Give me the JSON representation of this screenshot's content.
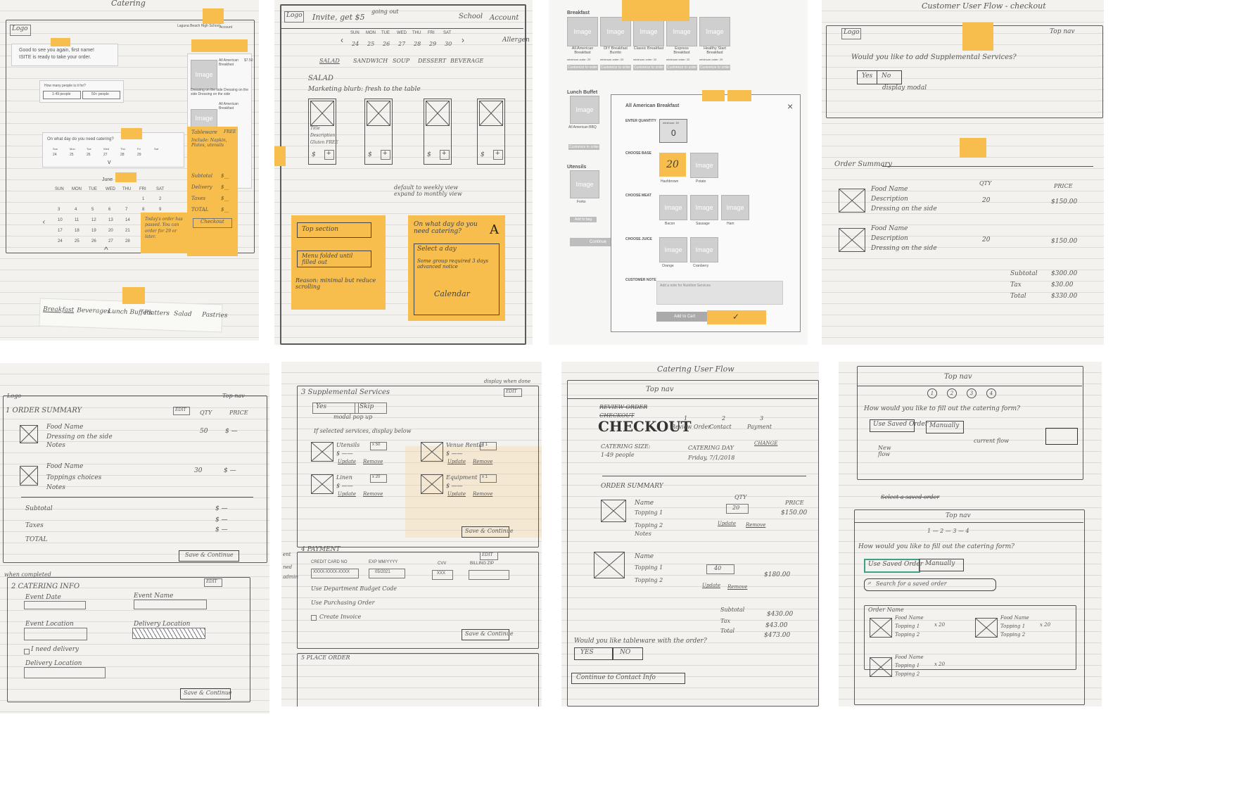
{
  "panels": {
    "p1": {
      "title": "Catering",
      "logo": "Logo",
      "school": "Laguna Beach High School",
      "account": "Account",
      "greeting": "Good to see you again, first name!",
      "ready": "ISITE is ready to take your order.",
      "people_q": "How many people is it for?",
      "people_opt1": "1-49 people",
      "people_opt2": "50+ people",
      "date_q": "On what day do you need catering?",
      "week_days": [
        "Sun",
        "Mon",
        "Tue",
        "Wed",
        "Thu",
        "Fri",
        "Sat"
      ],
      "week_dates": [
        "24",
        "25",
        "26",
        "27",
        "28",
        "29"
      ],
      "month": "June",
      "cal_days": [
        "SUN",
        "MON",
        "TUE",
        "WED",
        "THU",
        "FRI",
        "SAT"
      ],
      "cal_rows": [
        [
          "",
          "",
          "",
          "",
          "",
          "1",
          "2"
        ],
        [
          "3",
          "4",
          "5",
          "6",
          "7",
          "8",
          "9"
        ],
        [
          "10",
          "11",
          "12",
          "13",
          "14",
          "15",
          ""
        ],
        [
          "17",
          "18",
          "19",
          "20",
          "21",
          "",
          ""
        ],
        [
          "24",
          "25",
          "26",
          "27",
          "28",
          "",
          ""
        ]
      ],
      "card_title": "All American Breakfast",
      "card_price": "$7.50",
      "card_image": "Image",
      "dressing": "Dressing on the side Dressing on the side Dressing on the side",
      "card2_title": "All American Breakfast",
      "tableware": "Tableware",
      "free": "FREE",
      "tableware_note": "Include: Napkin, Plates, utensils",
      "subtotal": "Subtotal",
      "delivery": "Delivery",
      "taxes": "Taxes",
      "total": "TOTAL",
      "amount": "$__",
      "checkout": "Checkout",
      "note": "Today's order has passed. You can order for 29 or later.",
      "categories": [
        "Breakfast",
        "Beverages",
        "Lunch Buffets",
        "Platters",
        "Salad",
        "Pastries"
      ]
    },
    "p2": {
      "logo": "Logo",
      "invite": "Invite, get $5",
      "going_out": "going out",
      "school": "School",
      "account": "Account",
      "days": [
        "SUN",
        "MON",
        "TUE",
        "WED",
        "THU",
        "FRI",
        "SAT"
      ],
      "dates": [
        "24",
        "25",
        "26",
        "27",
        "28",
        "29",
        "30"
      ],
      "allergen": "Allergen",
      "tabs": [
        "SALAD",
        "SANDWICH",
        "SOUP",
        "DESSERT",
        "BEVERAGE"
      ],
      "section": "SALAD",
      "subtitle": "Marketing blurb: fresh to the table",
      "item_title": "Title",
      "item_desc": "Description",
      "item_free": "Gluten FREE",
      "dollar": "$",
      "default_note": "default to weekly view expand to monthly view",
      "sticky1_top": "Top section",
      "sticky1_menu": "Menu folded until filled out",
      "sticky1_reason": "Reason: minimal but reduce scrolling",
      "sticky2_q": "On what day do you need catering?",
      "sticky2_letter": "A",
      "sticky2_select": "Select a day",
      "sticky2_note": "Some group required 3 days advanced notice",
      "sticky2_cal": "Calendar"
    },
    "p3": {
      "breakfast": "Breakfast",
      "image": "Image",
      "b_items": [
        "All American Breakfast",
        "DIY Breakfast Burrito",
        "Classic Breakfast",
        "Express Breakfast",
        "Healthy Start Breakfast"
      ],
      "min_order": "minimum order: 20",
      "customize": "Customize to order",
      "lunch": "Lunch Buffet",
      "l_items": [
        "All American BBQ",
        "Asia"
      ],
      "utensils": "Utensils",
      "u_items": [
        "Forks"
      ],
      "add_to_bag": "Add to bag",
      "continue": "Continue",
      "modal_title": "All American Breakfast",
      "enter_qty": "ENTER QUANTITY",
      "qty_hint": "minimum: 20",
      "qty_value": "0",
      "choose_base": "CHOOSE BASE",
      "base_selected": "20",
      "base_opts": [
        "Hashbrown",
        "Potato"
      ],
      "choose_meat": "CHOOSE MEAT",
      "meat_opts": [
        "Bacon",
        "Sausage",
        "Ham"
      ],
      "choose_juice": "CHOOSE JUICE",
      "juice_opts": [
        "Orange",
        "Cranberry"
      ],
      "customer_note": "CUSTOMER NOTE",
      "note_placeholder": "Add a note for Nutrition Services",
      "add_to_cart": "Add to Cart",
      "close": "×"
    },
    "p4": {
      "title": "Customer User Flow - checkout",
      "logo": "Logo",
      "top_nav": "Top nav",
      "question": "Would you like to add Supplemental Services?",
      "yes": "Yes",
      "no": "No",
      "display_modal": "display modal",
      "summary": "Order Summary",
      "qty": "QTY",
      "price": "PRICE",
      "items": [
        {
          "name": "Food Name",
          "desc": "Description",
          "note": "Dressing on the side",
          "qty": "20",
          "price": "$150.00"
        },
        {
          "name": "Food Name",
          "desc": "Description",
          "note": "Dressing on the side",
          "qty": "20",
          "price": "$150.00"
        }
      ],
      "subtotal_label": "Subtotal",
      "subtotal": "$300.00",
      "tax_label": "Tax",
      "tax": "$30.00",
      "total_label": "Total",
      "total": "$330.00"
    },
    "p5": {
      "logo": "Logo",
      "top_nav": "Top nav",
      "summary": "1 ORDER SUMMARY",
      "edit": "EDIT",
      "qty": "QTY",
      "price": "PRICE",
      "item1": {
        "name": "Food Name",
        "l2": "Dressing on the side",
        "l3": "Notes",
        "qty": "50",
        "price": "$ —"
      },
      "item2": {
        "name": "Food Name",
        "l2": "Toppings choices",
        "l3": "Notes",
        "qty": "30",
        "price": "$ —"
      },
      "subtotal": "Subtotal",
      "taxes": "Taxes",
      "total": "TOTAL",
      "amount": "$ —",
      "save": "Save & Continue",
      "when_completed": "when completed",
      "catering_info": "2 CATERING INFO",
      "event_date": "Event Date",
      "event_name": "Event Name",
      "event_location": "Event Location",
      "delivery_location": "Delivery Location",
      "need_delivery": "I need delivery",
      "delivery_loc2": "Delivery Location"
    },
    "p6": {
      "display_when_done": "display when done",
      "edit": "EDIT",
      "supplemental": "3 Supplemental Services",
      "yes": "Yes",
      "skip": "Skip",
      "modal_popup": "modal pop up",
      "if_selected": "If selected services, display below",
      "utensils": "Utensils",
      "utensils_qty": "x 50",
      "venue": "Venue Rental",
      "venue_qty": "x 1",
      "linen": "Linen",
      "linen_qty": "x 20",
      "equipment": "Equipment",
      "equipment_qty": "x 1",
      "update": "Update",
      "remove": "Remove",
      "save": "Save & Continue",
      "payment": "4 PAYMENT",
      "cc_no": "CREDIT CARD NO",
      "cc_mask": "XXXX-XXXX-XXXX",
      "exp": "EXP MM/YYYY",
      "exp_val": "05/2021",
      "cvv": "CVV",
      "cvv_val": "XXX",
      "billing": "BILLING ZIP",
      "dept_budget": "Use Department Budget Code",
      "purchasing": "Use Purchasing Order",
      "create_invoice": "Create Invoice",
      "place_order": "5 PLACE ORDER",
      "side_notes": [
        "ent",
        "ned",
        "admin"
      ]
    },
    "p7": {
      "title": "Catering User Flow",
      "top_nav": "Top nav",
      "review_order": "REVIEW ORDER",
      "checkout_struck": "CHECKOUT",
      "checkout": "CHECKOUT",
      "steps": [
        "Review Order",
        "Contact",
        "Payment"
      ],
      "step_nums": [
        "1",
        "2",
        "3"
      ],
      "size_label": "CATERING SIZE:",
      "size_val": "1-49 people",
      "day_label": "CATERING DAY",
      "day_val": "Friday, 7/1/2018",
      "change": "CHANGE",
      "summary": "ORDER SUMMARY",
      "qty": "QTY",
      "price": "PRICE",
      "item1": {
        "name": "Name",
        "l1": "Topping 1",
        "l2": "Topping 2",
        "l3": "Notes",
        "qty": "20",
        "price": "$150.00"
      },
      "item2": {
        "name": "Name",
        "l1": "Topping 1",
        "l2": "Topping 2",
        "qty": "40",
        "price": "$180.00"
      },
      "update": "Update",
      "remove": "Remove",
      "subtotal_label": "Subtotal",
      "subtotal": "$430.00",
      "tax_label": "Tax",
      "tax": "$43.00",
      "total_label": "Total",
      "total": "$473.00",
      "tableware_q": "Would you like tableware with the order?",
      "yes": "YES",
      "no": "NO",
      "continue": "Continue to Contact Info"
    },
    "p8": {
      "top_nav": "Top nav",
      "steps": [
        "1",
        "2",
        "3",
        "4"
      ],
      "question": "How would you like to fill out the catering form?",
      "use_saved": "Use Saved Order",
      "manually": "Manually",
      "current_flow": "current flow",
      "new_flow": "New flow",
      "select_saved": "Select a saved order",
      "top_nav2": "Top nav",
      "steps2": "1 — 2 — 3 — 4",
      "question2": "How would you like to fill out the catering form?",
      "search": "Search for a saved order",
      "order_name": "Order Name",
      "food_name": "Food Name",
      "topping1": "Topping 1",
      "topping2": "Topping 2",
      "x20": "x 20"
    }
  }
}
